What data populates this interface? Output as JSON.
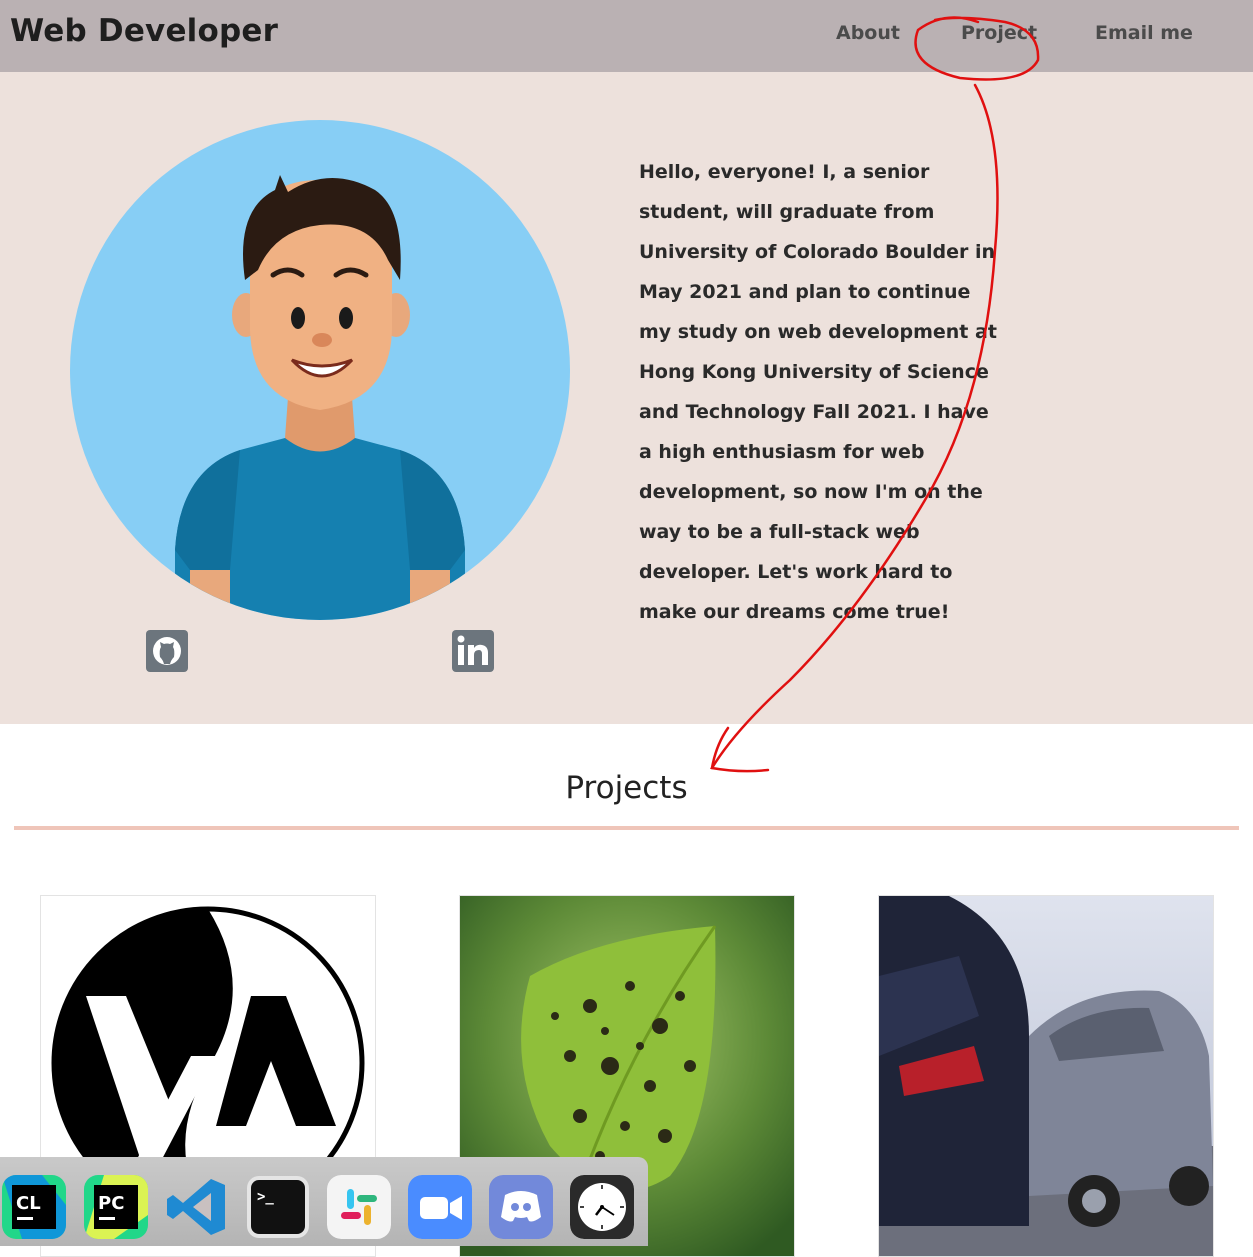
{
  "navbar": {
    "brand": "Web Developer",
    "links": [
      {
        "label": "About"
      },
      {
        "label": "Project"
      },
      {
        "label": "Email me"
      }
    ]
  },
  "hero": {
    "bio": "Hello, everyone! I, a senior student, will graduate from University of Colorado Boulder in May 2021 and plan to continue my study on web development at Hong Kong University of Science and Technology Fall 2021. I have a high enthusiasm for web development, so now I'm on the way to be a full-stack web developer. Let's work hard to make our dreams come true!",
    "social": [
      {
        "icon": "github-icon"
      },
      {
        "icon": "linkedin-icon"
      }
    ]
  },
  "projects": {
    "title": "Projects",
    "cards": [
      {
        "image": "yin-yang-lambda-logo"
      },
      {
        "image": "spotted-leaf-photo"
      },
      {
        "image": "car-crash-photo"
      }
    ]
  },
  "dock": {
    "apps": [
      {
        "icon": "clion-icon",
        "text": "CL"
      },
      {
        "icon": "pycharm-icon",
        "text": "PC"
      },
      {
        "icon": "vscode-icon"
      },
      {
        "icon": "terminal-icon",
        "text": ">_"
      },
      {
        "icon": "slack-icon"
      },
      {
        "icon": "zoom-icon"
      },
      {
        "icon": "discord-icon"
      },
      {
        "icon": "clock-icon"
      }
    ]
  },
  "colors": {
    "navbar": "#bab1b3",
    "hero": "#ede1dc",
    "divider": "#efc5b9",
    "annotation": "#e01010",
    "avatar_bg": "#87cef5"
  }
}
